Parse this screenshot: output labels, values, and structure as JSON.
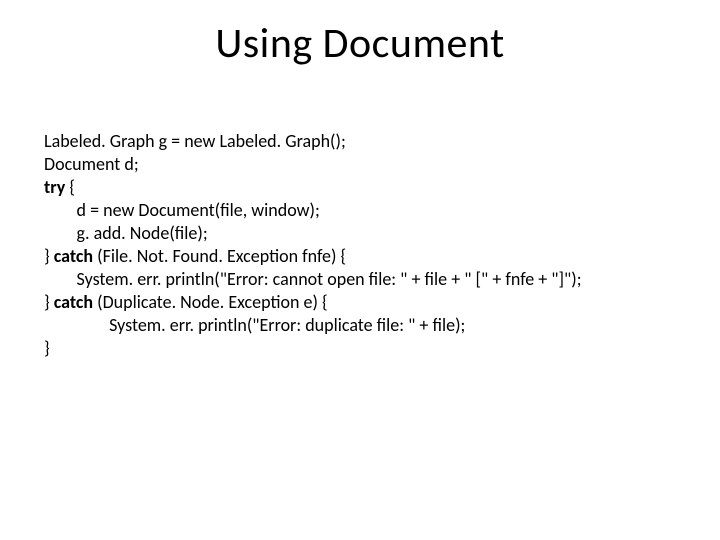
{
  "slide": {
    "title": "Using Document",
    "code": {
      "l1": "Labeled. Graph g = new Labeled. Graph();",
      "l2": "Document d;",
      "l3a": "try",
      "l3b": " {",
      "l4": "        d = new Document(file, window);",
      "l5": "        g. add. Node(file);",
      "l6a": "} ",
      "l6b": "catch",
      "l6c": " (File. Not. Found. Exception fnfe) {",
      "l7": "        System. err. println(\"Error: cannot open file: \" + file + \" [\" + fnfe + \"]\");",
      "l8a": "} ",
      "l8b": "catch",
      "l8c": " (Duplicate. Node. Exception e) {",
      "l9": "                System. err. println(\"Error: duplicate file: \" + file);",
      "l10": "}"
    }
  }
}
